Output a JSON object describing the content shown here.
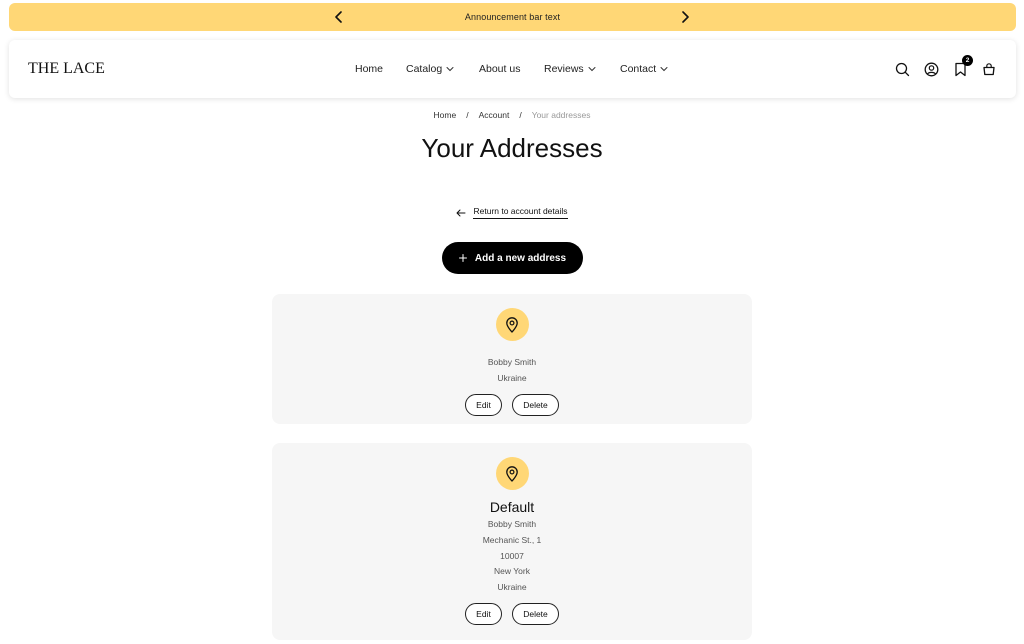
{
  "announcement": {
    "text": "Announcement bar text",
    "prev_icon": "chevron-left-icon",
    "next_icon": "chevron-right-icon"
  },
  "header": {
    "logo": "THE LACE",
    "nav": [
      {
        "label": "Home",
        "has_dropdown": false
      },
      {
        "label": "Catalog",
        "has_dropdown": true
      },
      {
        "label": "About us",
        "has_dropdown": false
      },
      {
        "label": "Reviews",
        "has_dropdown": true
      },
      {
        "label": "Contact",
        "has_dropdown": true
      }
    ],
    "icons": [
      "search-icon",
      "account-icon",
      "wishlist-icon",
      "cart-icon"
    ],
    "wishlist_count": "2"
  },
  "breadcrumb": {
    "items": [
      "Home",
      "Account",
      "Your addresses"
    ],
    "separator": "/"
  },
  "page": {
    "title": "Your Addresses",
    "return_label": "Return to account details",
    "add_label": "Add a new address"
  },
  "addresses": [
    {
      "title": "",
      "lines": [
        "Bobby Smith",
        "Ukraine"
      ],
      "edit_label": "Edit",
      "delete_label": "Delete"
    },
    {
      "title": "Default",
      "lines": [
        "Bobby Smith",
        "Mechanic St., 1",
        "10007",
        "New York",
        "Ukraine"
      ],
      "edit_label": "Edit",
      "delete_label": "Delete"
    }
  ],
  "colors": {
    "accent": "#ffd776",
    "button": "#000000",
    "card_bg": "#f6f6f6"
  }
}
